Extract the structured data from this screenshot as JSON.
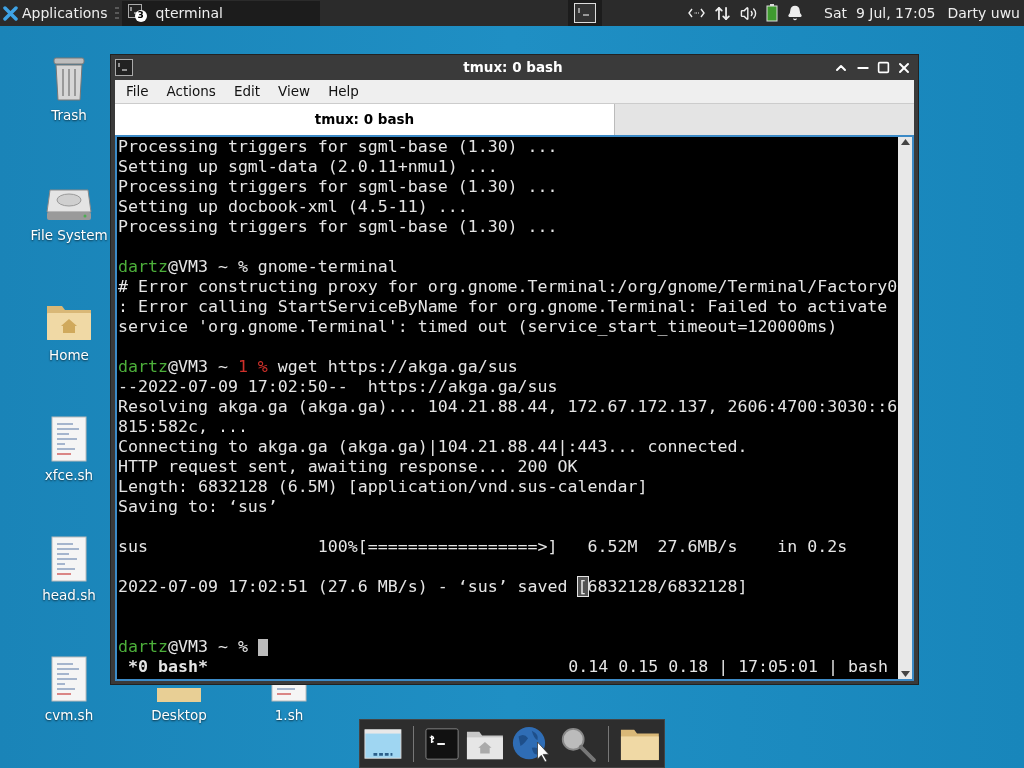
{
  "top_panel": {
    "applications": "Applications",
    "tasks": [
      {
        "label": "qterminal",
        "badge": "3",
        "selected": true
      }
    ],
    "clock": "Sat  9 Jul, 17:05",
    "user": "Darty uwu"
  },
  "desktop_columns": [
    [
      {
        "label": "Trash",
        "kind": "trash"
      },
      {
        "label": "File System",
        "kind": "drive"
      },
      {
        "label": "Home",
        "kind": "home"
      },
      {
        "label": "xfce.sh",
        "kind": "script"
      },
      {
        "label": "head.sh",
        "kind": "script"
      },
      {
        "label": "cvm.sh",
        "kind": "script"
      }
    ],
    [
      {
        "label": "Desktop",
        "kind": "folder"
      }
    ],
    [
      {
        "label": "1.sh",
        "kind": "script"
      }
    ]
  ],
  "window": {
    "title": "tmux: 0 bash",
    "menu": [
      "File",
      "Actions",
      "Edit",
      "View",
      "Help"
    ],
    "tabs": [
      {
        "label": "tmux: 0 bash",
        "selected": true
      }
    ],
    "terminal": {
      "lines": [
        {
          "kind": "text",
          "cursor": false,
          "segments": [
            {
              "kind": "text",
              "text": "Processing triggers for sgml-base (1.30) ..."
            }
          ]
        },
        {
          "kind": "text",
          "cursor": false,
          "segments": [
            {
              "kind": "text",
              "text": "Setting up sgml-data (2.0.11+nmu1) ..."
            }
          ]
        },
        {
          "kind": "text",
          "cursor": false,
          "segments": [
            {
              "kind": "text",
              "text": "Processing triggers for sgml-base (1.30) ..."
            }
          ]
        },
        {
          "kind": "text",
          "cursor": false,
          "segments": [
            {
              "kind": "text",
              "text": "Setting up docbook-xml (4.5-11) ..."
            }
          ]
        },
        {
          "kind": "text",
          "cursor": false,
          "segments": [
            {
              "kind": "text",
              "text": "Processing triggers for sgml-base (1.30) ..."
            }
          ]
        },
        {
          "kind": "blank"
        },
        {
          "kind": "text",
          "cursor": false,
          "segments": [
            {
              "kind": "user",
              "text": "dartz"
            },
            {
              "kind": "text",
              "text": "@VM3 ~ % gnome-terminal"
            }
          ]
        },
        {
          "kind": "text",
          "cursor": false,
          "segments": [
            {
              "kind": "text",
              "text": "# Error constructing proxy for org.gnome.Terminal:/org/gnome/Terminal/Factory0"
            }
          ]
        },
        {
          "kind": "text",
          "cursor": false,
          "segments": [
            {
              "kind": "text",
              "text": ": Error calling StartServiceByName for org.gnome.Terminal: Failed to activate"
            }
          ]
        },
        {
          "kind": "text",
          "cursor": false,
          "segments": [
            {
              "kind": "text",
              "text": "service 'org.gnome.Terminal': timed out (service_start_timeout=120000ms)"
            }
          ]
        },
        {
          "kind": "blank"
        },
        {
          "kind": "text",
          "cursor": false,
          "segments": [
            {
              "kind": "user",
              "text": "dartz"
            },
            {
              "kind": "text",
              "text": "@VM3 ~ "
            },
            {
              "kind": "alert",
              "text": "1 %"
            },
            {
              "kind": "text",
              "text": " wget https://akga.ga/sus"
            }
          ]
        },
        {
          "kind": "text",
          "cursor": false,
          "segments": [
            {
              "kind": "text",
              "text": "--2022-07-09 17:02:50--  https://akga.ga/sus"
            }
          ]
        },
        {
          "kind": "text",
          "cursor": false,
          "segments": [
            {
              "kind": "text",
              "text": "Resolving akga.ga (akga.ga)... 104.21.88.44, 172.67.172.137, 2606:4700:3030::6"
            }
          ]
        },
        {
          "kind": "text",
          "cursor": false,
          "segments": [
            {
              "kind": "text",
              "text": "815:582c, ..."
            }
          ]
        },
        {
          "kind": "text",
          "cursor": false,
          "segments": [
            {
              "kind": "text",
              "text": "Connecting to akga.ga (akga.ga)|104.21.88.44|:443... connected."
            }
          ]
        },
        {
          "kind": "text",
          "cursor": false,
          "segments": [
            {
              "kind": "text",
              "text": "HTTP request sent, awaiting response... 200 OK"
            }
          ]
        },
        {
          "kind": "text",
          "cursor": false,
          "segments": [
            {
              "kind": "text",
              "text": "Length: 6832128 (6.5M) [application/vnd.sus-calendar]"
            }
          ]
        },
        {
          "kind": "text",
          "cursor": false,
          "segments": [
            {
              "kind": "text",
              "text": "Saving to: ‘sus’"
            }
          ]
        },
        {
          "kind": "blank"
        },
        {
          "kind": "text",
          "cursor": false,
          "segments": [
            {
              "kind": "text",
              "text": "sus                 100%[=================>]   6.52M  27.6MB/s    in 0.2s"
            }
          ]
        },
        {
          "kind": "blank"
        },
        {
          "kind": "text",
          "cursor": false,
          "segments": [
            {
              "kind": "text",
              "text": "2022-07-09 17:02:51 (27.6 MB/s) - ‘sus’ saved "
            },
            {
              "kind": "highlight",
              "text": "["
            },
            {
              "kind": "text",
              "text": "6832128/6832128]"
            }
          ]
        },
        {
          "kind": "blank"
        },
        {
          "kind": "blank"
        },
        {
          "kind": "text",
          "cursor": true,
          "segments": [
            {
              "kind": "user",
              "text": "dartz"
            },
            {
              "kind": "text",
              "text": "@VM3 ~ % "
            }
          ]
        }
      ],
      "status_left": "*0 bash*",
      "status_right": "0.14 0.15 0.18 | 17:05:01 | bash"
    }
  },
  "dock": {
    "items": [
      {
        "kind": "show-desktop"
      },
      {
        "kind": "separator"
      },
      {
        "kind": "terminal"
      },
      {
        "kind": "home"
      },
      {
        "kind": "globe"
      },
      {
        "kind": "search"
      },
      {
        "kind": "separator"
      },
      {
        "kind": "folder"
      }
    ]
  }
}
